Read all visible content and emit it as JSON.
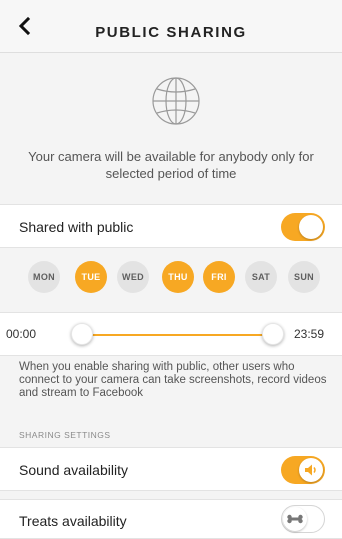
{
  "header": {
    "title": "PUBLIC SHARING",
    "back_icon": "chevron-left-icon"
  },
  "intro": {
    "icon": "globe-icon",
    "text": "Your camera will be available for anybody only for selected period of time"
  },
  "shared_with_public": {
    "label": "Shared with public",
    "enabled": true
  },
  "days": [
    {
      "label": "MON",
      "selected": false
    },
    {
      "label": "TUE",
      "selected": true
    },
    {
      "label": "WED",
      "selected": false
    },
    {
      "label": "THU",
      "selected": true
    },
    {
      "label": "FRI",
      "selected": true
    },
    {
      "label": "SAT",
      "selected": false
    },
    {
      "label": "SUN",
      "selected": false
    }
  ],
  "time_range": {
    "start": "00:00",
    "end": "23:59"
  },
  "note": "When you enable sharing with public, other users who connect to your camera can take screenshots, record videos and stream to Facebook",
  "sharing_settings": {
    "section_title": "SHARING SETTINGS",
    "sound": {
      "label": "Sound availability",
      "enabled": true,
      "icon": "speaker-icon"
    },
    "treats": {
      "label": "Treats availability",
      "enabled": false,
      "icon": "bone-icon"
    }
  },
  "colors": {
    "accent": "#f7a823"
  }
}
